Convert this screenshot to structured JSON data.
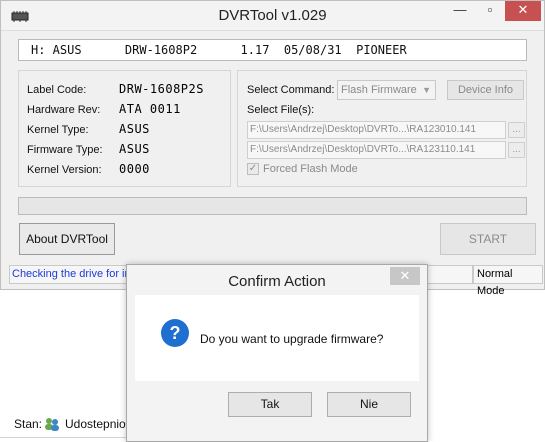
{
  "window": {
    "title": "DVRTool v1.029",
    "minimize_glyph": "—",
    "maximize_glyph": "▫",
    "close_glyph": "✕"
  },
  "drive": {
    "selected": "H: ASUS      DRW-1608P2      1.17  05/08/31  PIONEER"
  },
  "info": {
    "labels": [
      "Label Code:",
      "Hardware Rev:",
      "Kernel Type:",
      "Firmware Type:",
      "Kernel Version:"
    ],
    "values": [
      "DRW-1608P2S",
      "ATA 0011",
      "ASUS",
      "ASUS",
      "0000"
    ]
  },
  "command": {
    "select_command_label": "Select Command:",
    "selected_command": "Flash Firmware",
    "device_info_label": "Device Info",
    "select_files_label": "Select File(s):",
    "file1": "F:\\Users\\Andrzej\\Desktop\\DVRTo...\\RA123010.141",
    "file2": "F:\\Users\\Andrzej\\Desktop\\DVRTo...\\RA123110.141",
    "browse_label": "...",
    "forced_flash_label": "Forced Flash Mode",
    "forced_flash_checked": true
  },
  "buttons": {
    "about": "About DVRTool",
    "start": "START"
  },
  "status": {
    "message": "Checking the drive for in",
    "mode": "Normal Mode"
  },
  "dialog": {
    "title": "Confirm Action",
    "close_glyph": "✕",
    "message": "Do you want to upgrade firmware?",
    "yes": "Tak",
    "no": "Nie"
  },
  "background": {
    "stan_label": "Stan:",
    "share_label": "Udostepnio"
  },
  "colors": {
    "question_icon": "#1e6fd0",
    "status_text": "#1a3bd8",
    "close_button": "#c75050"
  }
}
